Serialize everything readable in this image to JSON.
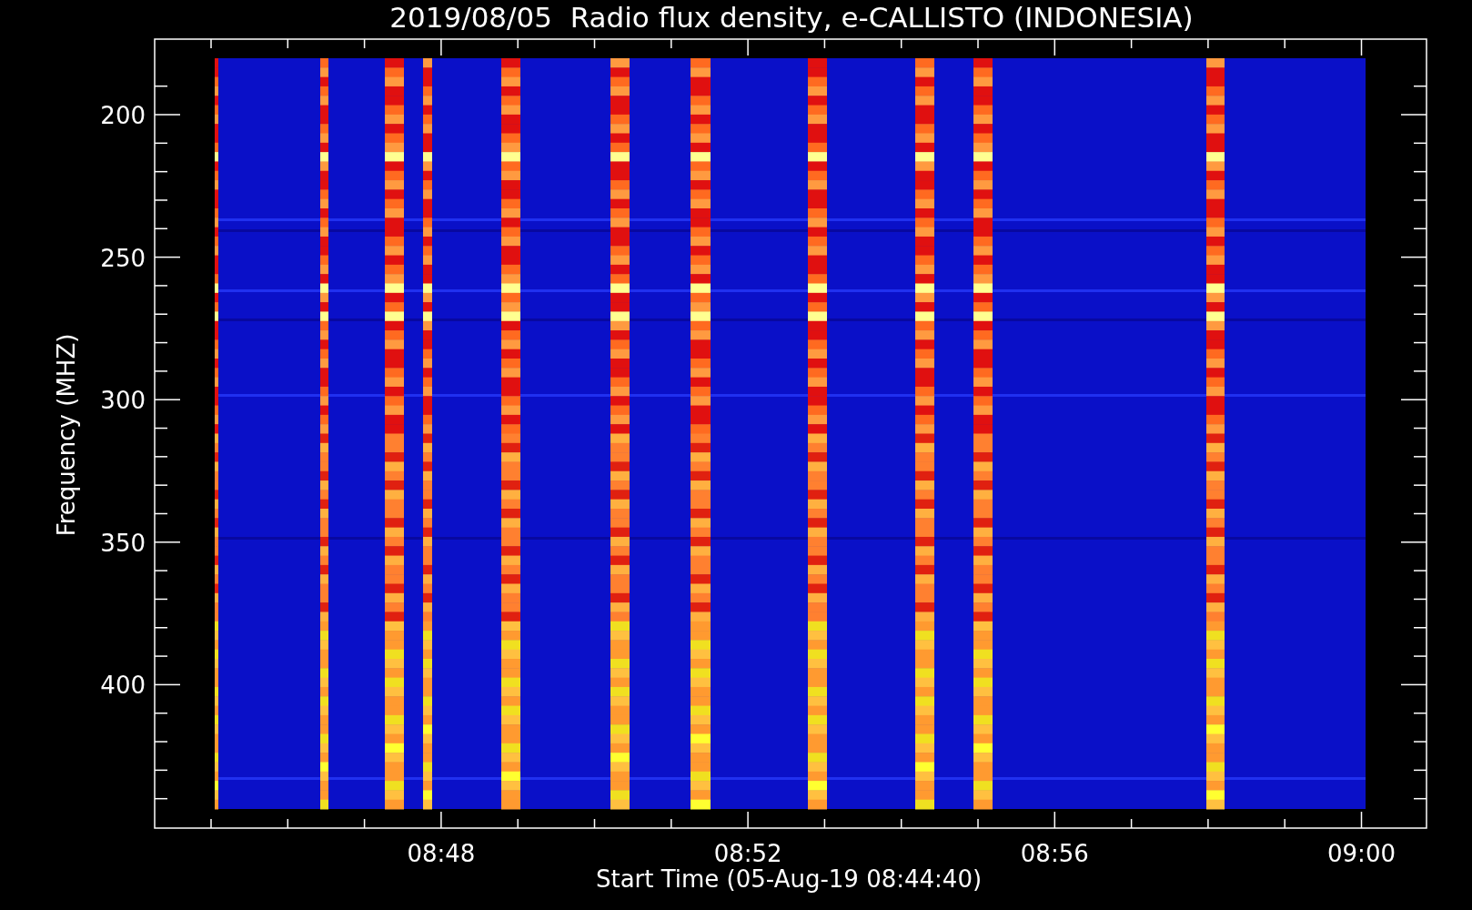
{
  "title": "2019/08/05  Radio flux density, e-CALLISTO (INDONESIA)",
  "y_axis": {
    "label": "Frequency (MHZ)",
    "ticks": [
      "200",
      "250",
      "300",
      "350",
      "400"
    ]
  },
  "x_axis": {
    "label": "Start Time (05-Aug-19 08:44:40)",
    "ticks": [
      "08:48",
      "08:52",
      "08:56",
      "09:00"
    ]
  }
}
